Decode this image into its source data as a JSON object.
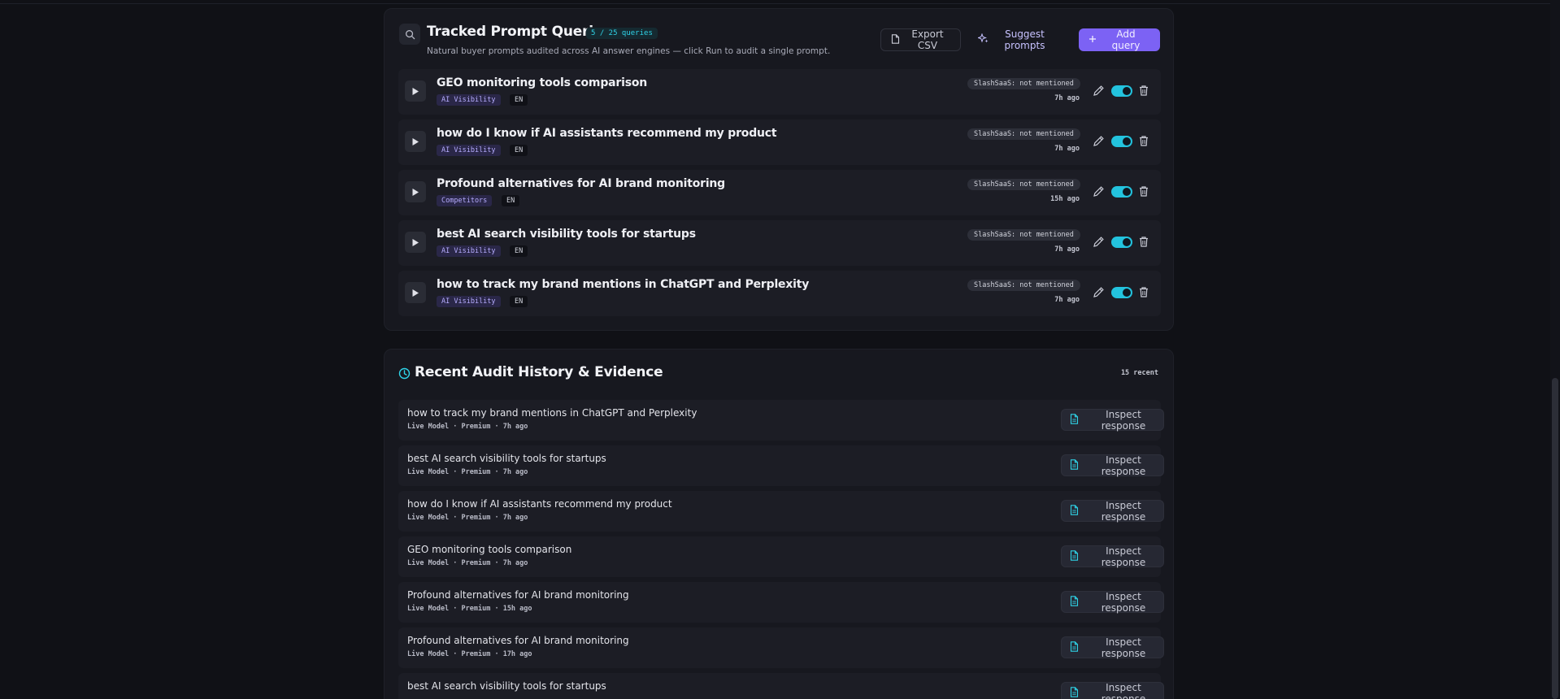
{
  "tracked": {
    "title": "Tracked Prompt Queries",
    "count_badge": "5 / 25 queries",
    "subtitle": "Natural buyer prompts audited across AI answer engines — click Run to audit a single prompt.",
    "buttons": {
      "export": "Export CSV",
      "suggest": "Suggest prompts",
      "add": "Add query"
    },
    "rows": [
      {
        "text": "GEO monitoring tools comparison",
        "category": "AI Visibility",
        "lang": "EN",
        "mention": "SlashSaaS: not mentioned",
        "ago": "7h ago",
        "enabled": true
      },
      {
        "text": "how do I know if AI assistants recommend my product",
        "category": "AI Visibility",
        "lang": "EN",
        "mention": "SlashSaaS: not mentioned",
        "ago": "7h ago",
        "enabled": true
      },
      {
        "text": "Profound alternatives for AI brand monitoring",
        "category": "Competitors",
        "lang": "EN",
        "mention": "SlashSaaS: not mentioned",
        "ago": "15h ago",
        "enabled": true
      },
      {
        "text": "best AI search visibility tools for startups",
        "category": "AI Visibility",
        "lang": "EN",
        "mention": "SlashSaaS: not mentioned",
        "ago": "7h ago",
        "enabled": true
      },
      {
        "text": "how to track my brand mentions in ChatGPT and Perplexity",
        "category": "AI Visibility",
        "lang": "EN",
        "mention": "SlashSaaS: not mentioned",
        "ago": "7h ago",
        "enabled": true
      }
    ]
  },
  "history": {
    "title": "Recent Audit History & Evidence",
    "count_badge": "15 recent",
    "inspect_label": "Inspect response",
    "rows": [
      {
        "text": "how to track my brand mentions in ChatGPT and Perplexity",
        "meta": "Live Model · Premium · 7h ago"
      },
      {
        "text": "best AI search visibility tools for startups",
        "meta": "Live Model · Premium · 7h ago"
      },
      {
        "text": "how do I know if AI assistants recommend my product",
        "meta": "Live Model · Premium · 7h ago"
      },
      {
        "text": "GEO monitoring tools comparison",
        "meta": "Live Model · Premium · 7h ago"
      },
      {
        "text": "Profound alternatives for AI brand monitoring",
        "meta": "Live Model · Premium · 15h ago"
      },
      {
        "text": "Profound alternatives for AI brand monitoring",
        "meta": "Live Model · Premium · 17h ago"
      },
      {
        "text": "best AI search visibility tools for startups",
        "meta": ""
      }
    ]
  },
  "colors": {
    "accent": "#7c62f4",
    "toggle_on": "#23c3de",
    "badge_cyan": "#2fd4e8"
  },
  "icons": [
    "search-icon",
    "file-icon",
    "sparkles-icon",
    "plus-icon",
    "play-icon",
    "pencil-icon",
    "trash-icon",
    "clock-icon",
    "document-icon"
  ]
}
